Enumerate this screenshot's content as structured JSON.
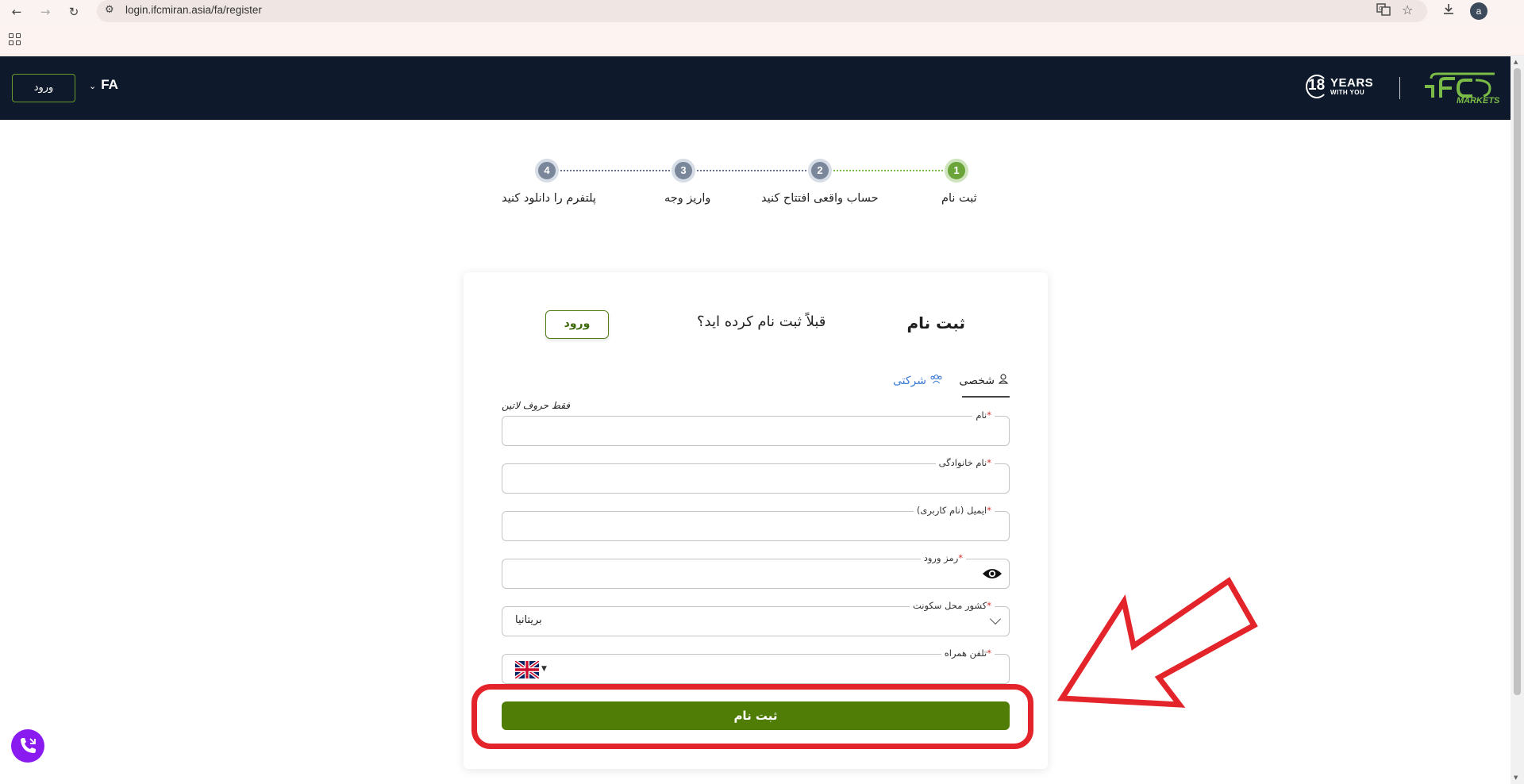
{
  "browser": {
    "url": "login.ifcmiran.asia/fa/register",
    "avatar_letter": "a",
    "icons": [
      "back-icon",
      "forward-icon",
      "reload-icon",
      "site-settings-icon",
      "translate-icon",
      "bookmark-star-icon",
      "download-icon",
      "apps-icon"
    ]
  },
  "header": {
    "login_label": "ورود",
    "language": "FA",
    "years_number": "18",
    "years_word": "YEARS",
    "years_sub": "WITH YOU",
    "logo_text": "IFC",
    "logo_sub": "MARKETS",
    "brand_color": "#0e1a2b",
    "logo_color": "#7bbb47"
  },
  "stepper": {
    "steps": [
      {
        "number": "1",
        "label": "ثبت نام",
        "active": true
      },
      {
        "number": "2",
        "label": "حساب واقعی افتتاح کنید",
        "active": false
      },
      {
        "number": "3",
        "label": "واریز وجه",
        "active": false
      },
      {
        "number": "4",
        "label": "پلتفرم را دانلود کنید",
        "active": false
      }
    ]
  },
  "card": {
    "title": "ثبت نام",
    "question": "قبلاً ثبت نام کرده اید؟",
    "login_label": "ورود",
    "tabs": {
      "personal": "شخصی",
      "company": "شرکتی"
    },
    "latin_hint": "فقط حروف لاتین",
    "fields": {
      "first_name": {
        "label": "نام",
        "required": "*",
        "value": ""
      },
      "last_name": {
        "label": "نام خانوادگی",
        "required": "*",
        "value": ""
      },
      "email": {
        "label": "ایمیل (نام کاربری)",
        "required": "*",
        "value": ""
      },
      "password": {
        "label": "رمز ورود",
        "required": "*",
        "value": ""
      },
      "country": {
        "label": "کشور محل سکونت",
        "required": "*",
        "value": "بریتانیا"
      },
      "phone": {
        "label": "تلفن همراه",
        "required": "*",
        "value": ""
      }
    },
    "submit_label": "ثبت نام",
    "accent_color": "#4f7d06"
  },
  "annotation": {
    "color": "#e4242b"
  }
}
